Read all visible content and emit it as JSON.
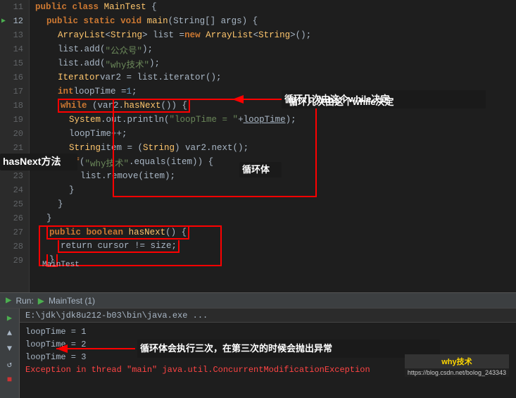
{
  "editor": {
    "lines": [
      {
        "num": 11,
        "indent": 0,
        "tokens": [
          {
            "t": "kw",
            "v": "public"
          },
          {
            "t": "sp",
            "v": " "
          },
          {
            "t": "kw",
            "v": "class"
          },
          {
            "t": "sp",
            "v": " "
          },
          {
            "t": "cls",
            "v": "MainTest"
          },
          {
            "t": "sp",
            "v": " {"
          }
        ]
      },
      {
        "num": 12,
        "indent": 1,
        "tokens": [
          {
            "t": "kw",
            "v": "public"
          },
          {
            "t": "sp",
            "v": " "
          },
          {
            "t": "kw",
            "v": "static"
          },
          {
            "t": "sp",
            "v": " "
          },
          {
            "t": "kw",
            "v": "void"
          },
          {
            "t": "sp",
            "v": " "
          },
          {
            "t": "method",
            "v": "main"
          },
          {
            "t": "sp",
            "v": "(String[] args) {"
          }
        ],
        "hasRun": true
      },
      {
        "num": 13,
        "indent": 2,
        "tokens": [
          {
            "t": "cls",
            "v": "ArrayList"
          },
          {
            "t": "sp",
            "v": "<"
          },
          {
            "t": "cls",
            "v": "String"
          },
          {
            "t": "sp",
            "v": "> list = "
          },
          {
            "t": "kw",
            "v": "new"
          },
          {
            "t": "sp",
            "v": " "
          },
          {
            "t": "cls",
            "v": "ArrayList"
          },
          {
            "t": "sp",
            "v": "<"
          },
          {
            "t": "cls",
            "v": "String"
          },
          {
            "t": "sp",
            "v": ">();"
          }
        ]
      },
      {
        "num": 14,
        "indent": 2,
        "tokens": [
          {
            "t": "sp",
            "v": "list.add("
          },
          {
            "t": "str",
            "v": "\"公众号\""
          },
          {
            "t": "sp",
            "v": ");"
          }
        ]
      },
      {
        "num": 15,
        "indent": 2,
        "tokens": [
          {
            "t": "sp",
            "v": "list.add("
          },
          {
            "t": "str",
            "v": "\"why技术\""
          },
          {
            "t": "sp",
            "v": ");"
          }
        ]
      },
      {
        "num": 16,
        "indent": 2,
        "tokens": [
          {
            "t": "cls",
            "v": "Iterator"
          },
          {
            "t": "sp",
            "v": " var2 = list.iterator();"
          }
        ]
      },
      {
        "num": 17,
        "indent": 2,
        "tokens": [
          {
            "t": "kw",
            "v": "int"
          },
          {
            "t": "sp",
            "v": " loopTime = "
          },
          {
            "t": "num",
            "v": "1"
          },
          {
            "t": "sp",
            "v": ";"
          }
        ]
      },
      {
        "num": 18,
        "indent": 2,
        "tokens": [
          {
            "t": "kw",
            "v": "while"
          },
          {
            "t": "sp",
            "v": " (var2."
          },
          {
            "t": "method",
            "v": "hasNext"
          },
          {
            "t": "sp",
            "v": "()) {"
          }
        ],
        "redBox": true
      },
      {
        "num": 19,
        "indent": 3,
        "tokens": [
          {
            "t": "cls",
            "v": "System"
          },
          {
            "t": "sp",
            "v": ".out.println("
          },
          {
            "t": "str",
            "v": "\"loopTime = \""
          },
          {
            "t": "sp",
            "v": " + "
          },
          {
            "t": "underline",
            "v": "loopTime"
          },
          {
            "t": "sp",
            "v": ");"
          }
        ]
      },
      {
        "num": 20,
        "indent": 3,
        "tokens": [
          {
            "t": "sp",
            "v": "loopTime++;"
          }
        ]
      },
      {
        "num": 21,
        "indent": 3,
        "tokens": [
          {
            "t": "cls",
            "v": "String"
          },
          {
            "t": "sp",
            "v": " item = ("
          },
          {
            "t": "cls",
            "v": "String"
          },
          {
            "t": "sp",
            "v": ") var2.next();"
          }
        ]
      },
      {
        "num": 22,
        "indent": 3,
        "tokens": [
          {
            "t": "kw",
            "v": "if"
          },
          {
            "t": "sp",
            "v": " ("
          },
          {
            "t": "str",
            "v": "\"why技术\""
          },
          {
            "t": "sp",
            "v": ".equals(item)) {"
          }
        ]
      },
      {
        "num": 23,
        "indent": 4,
        "tokens": [
          {
            "t": "sp",
            "v": "list.remove(item);"
          }
        ]
      },
      {
        "num": 24,
        "indent": 3,
        "tokens": [
          {
            "t": "sp",
            "v": "}"
          }
        ]
      },
      {
        "num": 25,
        "indent": 2,
        "tokens": [
          {
            "t": "sp",
            "v": "}"
          }
        ]
      },
      {
        "num": 26,
        "indent": 1,
        "tokens": [
          {
            "t": "sp",
            "v": "}"
          }
        ]
      },
      {
        "num": 27,
        "indent": 1,
        "tokens": [
          {
            "t": "kw",
            "v": "public"
          },
          {
            "t": "sp",
            "v": " "
          },
          {
            "t": "kw",
            "v": "boolean"
          },
          {
            "t": "sp",
            "v": " "
          },
          {
            "t": "method",
            "v": "hasNext"
          },
          {
            "t": "sp",
            "v": "() {"
          }
        ],
        "redBox2": true
      },
      {
        "num": 28,
        "indent": 2,
        "tokens": [
          {
            "t": "sp",
            "v": "return cursor != size;"
          }
        ]
      },
      {
        "num": 29,
        "indent": 1,
        "tokens": [
          {
            "t": "sp",
            "v": "}"
          }
        ]
      }
    ],
    "annotations": {
      "whileLabel": "循环几次由这个while决定",
      "hasNextLabel": "hasNext方法",
      "loopBodyLabel": "循环体",
      "consoleAnnotation": "循环体会执行三次，在第三次的时候会抛出异常",
      "mainTestLabel": "MainTest"
    }
  },
  "runBar": {
    "label": "Run:",
    "runText": "MainTest (1)"
  },
  "console": {
    "path": "E:\\jdk\\jdk8u212-b03\\bin\\java.exe ...",
    "lines": [
      {
        "text": "loopTime = 1",
        "isError": false
      },
      {
        "text": "loopTime = 2",
        "isError": false
      },
      {
        "text": "loopTime = 3",
        "isError": false
      },
      {
        "text": "Exception in thread \"main\" java.util.ConcurrentModificationException",
        "isError": true
      }
    ]
  },
  "watermark": {
    "topText": "why技术",
    "bottomText": "https://blog.csdn.net/bolog_243343"
  }
}
